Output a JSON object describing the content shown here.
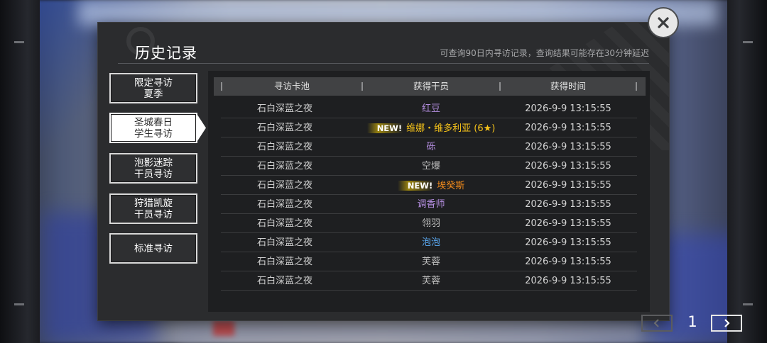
{
  "dialog": {
    "title": "历史记录",
    "subtitle": "可查询90日内寻访记录，查询结果可能存在30分钟延迟"
  },
  "tabs": [
    {
      "label": "限定寻访\n夏季",
      "active": false
    },
    {
      "label": "圣城春日\n学生寻访",
      "active": true
    },
    {
      "label": "泡影迷踪\n干员寻访",
      "active": false
    },
    {
      "label": "狩猎凯旋\n干员寻访",
      "active": false
    },
    {
      "label": "标准寻访",
      "active": false
    }
  ],
  "table": {
    "headers": [
      "寻访卡池",
      "获得干员",
      "获得时间"
    ],
    "rows": [
      {
        "pool": "石白深蓝之夜",
        "operator": "红豆",
        "color": "#b48ee0",
        "new": false,
        "time": "2026-9-9 13:15:55"
      },
      {
        "pool": "石白深蓝之夜",
        "operator": "维娜・维多利亚 (6★)",
        "color": "#f5c21a",
        "new": true,
        "time": "2026-9-9 13:15:55"
      },
      {
        "pool": "石白深蓝之夜",
        "operator": "砾",
        "color": "#b48ee0",
        "new": false,
        "time": "2026-9-9 13:15:55"
      },
      {
        "pool": "石白深蓝之夜",
        "operator": "空爆",
        "color": "#bdbdbd",
        "new": false,
        "time": "2026-9-9 13:15:55"
      },
      {
        "pool": "石白深蓝之夜",
        "operator": "埃癸斯",
        "color": "#f08a1c",
        "new": true,
        "time": "2026-9-9 13:15:55"
      },
      {
        "pool": "石白深蓝之夜",
        "operator": "调香师",
        "color": "#b48ee0",
        "new": false,
        "time": "2026-9-9 13:15:55"
      },
      {
        "pool": "石白深蓝之夜",
        "operator": "翎羽",
        "color": "#bdbdbd",
        "new": false,
        "time": "2026-9-9 13:15:55"
      },
      {
        "pool": "石白深蓝之夜",
        "operator": "泡泡",
        "color": "#5aa8f0",
        "new": false,
        "time": "2026-9-9 13:15:55"
      },
      {
        "pool": "石白深蓝之夜",
        "operator": "芙蓉",
        "color": "#bdbdbd",
        "new": false,
        "time": "2026-9-9 13:15:55"
      },
      {
        "pool": "石白深蓝之夜",
        "operator": "芙蓉",
        "color": "#bdbdbd",
        "new": false,
        "time": "2026-9-9 13:15:55"
      }
    ],
    "new_label": "NEW!"
  },
  "pagination": {
    "current_page": "1"
  },
  "icons": {
    "close": "close-icon",
    "prev": "chevron-left-icon",
    "next": "chevron-right-icon"
  }
}
